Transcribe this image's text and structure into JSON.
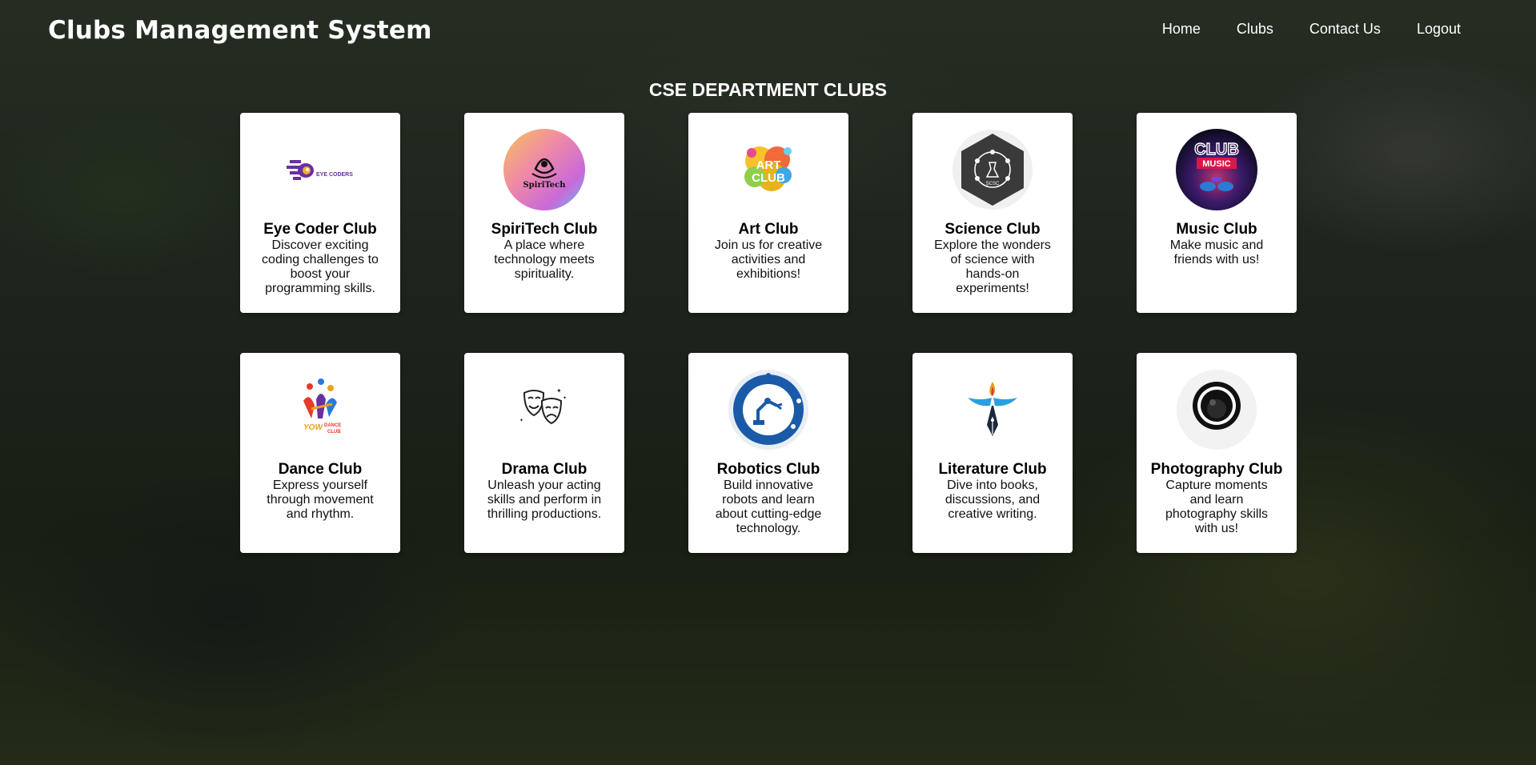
{
  "navbar": {
    "brand": "Clubs Management System",
    "links": [
      "Home",
      "Clubs",
      "Contact Us",
      "Logout"
    ]
  },
  "page_title": "CSE DEPARTMENT CLUBS",
  "clubs": [
    {
      "name": "Eye Coder Club",
      "description": "Discover exciting coding challenges to boost your programming skills.",
      "logo_text": "EYE CODERS",
      "logo": "eye-coders-logo"
    },
    {
      "name": "SpiriTech Club",
      "description": "A place where technology meets spirituality.",
      "logo_text": "SpiriTech",
      "logo": "spiritech-logo"
    },
    {
      "name": "Art Club",
      "description": "Join us for creative activities and exhibitions!",
      "logo_text": "ART CLUB",
      "logo": "art-club-logo"
    },
    {
      "name": "Science Club",
      "description": "Explore the wonders of science with hands-on experiments!",
      "logo_text": "SCSC",
      "logo": "science-club-logo"
    },
    {
      "name": "Music Club",
      "description": "Make music and friends with us!",
      "logo_text": "CLUB MUSIC",
      "logo": "music-club-logo"
    },
    {
      "name": "Dance Club",
      "description": "Express yourself through movement and rhythm.",
      "logo_text": "DANCE CLUB",
      "logo": "dance-club-logo"
    },
    {
      "name": "Drama Club",
      "description": "Unleash your acting skills and perform in thrilling productions.",
      "logo_text": "",
      "logo": "drama-masks-logo"
    },
    {
      "name": "Robotics Club",
      "description": "Build innovative robots and learn about cutting-edge technology.",
      "logo_text": "",
      "logo": "robotics-club-logo"
    },
    {
      "name": "Literature Club",
      "description": "Dive into books, discussions, and creative writing.",
      "logo_text": "",
      "logo": "literature-pen-logo"
    },
    {
      "name": "Photography Club",
      "description": "Capture moments and learn photography skills with us!",
      "logo_text": "",
      "logo": "photography-lens-logo"
    }
  ],
  "colors": {
    "card_bg": "#ffffff",
    "nav_text": "#ffffff"
  }
}
